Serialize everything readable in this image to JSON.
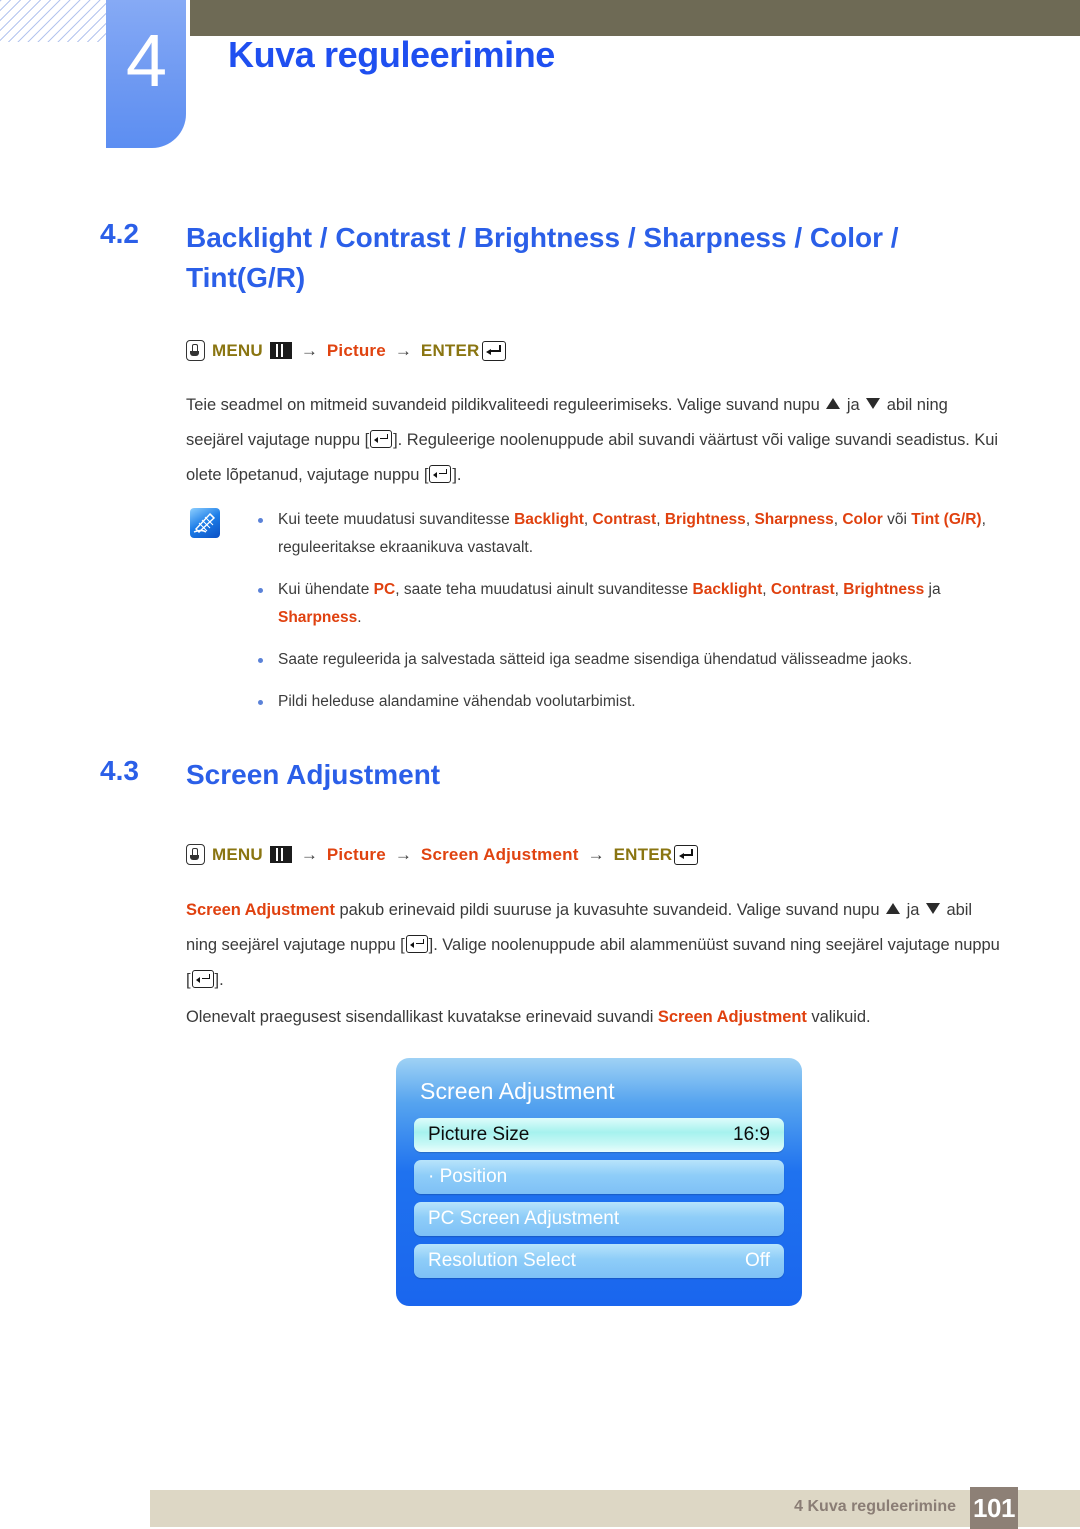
{
  "chapter": {
    "number": "4",
    "title": "Kuva reguleerimine"
  },
  "sections": [
    {
      "number": "4.2",
      "title": "Backlight / Contrast / Brightness / Sharpness / Color / Tint(G/R)",
      "path": {
        "menu_label": "MENU",
        "item_label": "Picture",
        "enter_label": "ENTER",
        "arrow": "→"
      }
    },
    {
      "number": "4.3",
      "title": "Screen Adjustment",
      "path": {
        "menu_label": "MENU",
        "item_label": "Picture",
        "item2_label": "Screen Adjustment",
        "enter_label": "ENTER",
        "arrow": "→"
      }
    }
  ],
  "body": {
    "para1_a": "Teie seadmel on mitmeid suvandeid pildikvaliteedi reguleerimiseks. Valige suvand nupu",
    "para1_b": "ja",
    "para1_c": "abil ning seejärel vajutage nuppu [",
    "para1_d": "]. Reguleerige noolenuppude abil suvandi väärtust või valige suvandi seadistus. Kui olete lõpetanud, vajutage nuppu [",
    "para1_e": "].",
    "para2_kw": "Screen Adjustment",
    "para2_a": "pakub erinevaid pildi suuruse ja kuvasuhte suvandeid. Valige suvand nupu",
    "para2_b": "ja",
    "para2_c": "abil ning seejärel vajutage nuppu [",
    "para2_d": "]. Valige noolenuppude abil alammenüüst suvand ning seejärel vajutage nuppu [",
    "para2_e": "].",
    "para3_a": "Olenevalt praegusest sisendallikast kuvatakse erinevaid suvandi",
    "para3_kw": "Screen Adjustment",
    "para3_b": "valikuid."
  },
  "notes": [
    {
      "prefix": "Kui teete muudatusi suvanditesse",
      "kw1": "Backlight",
      "kw2": "Contrast",
      "kw3": "Brightness",
      "kw4": "Sharpness",
      "kw5": "Color",
      "mid": "või",
      "kw6": "Tint (G/R)",
      "suffix": ", reguleeritakse ekraanikuva vastavalt."
    },
    {
      "prefix": "Kui ühendate",
      "kw1": "PC",
      "mid": ", saate teha muudatusi ainult suvanditesse",
      "kw2": "Backlight",
      "kw3": "Contrast",
      "kw4": "Brightness",
      "conj": "ja",
      "kw5": "Sharpness",
      "suffix": "."
    },
    {
      "text": "Saate reguleerida ja salvestada sätteid iga seadme sisendiga ühendatud välisseadme jaoks."
    },
    {
      "text": "Pildi heleduse alandamine vähendab voolutarbimist."
    }
  ],
  "osd": {
    "title": "Screen Adjustment",
    "rows": [
      {
        "label": "Picture Size",
        "value": "16:9",
        "selected": true
      },
      {
        "label": "· Position",
        "value": "",
        "selected": false
      },
      {
        "label": "PC Screen Adjustment",
        "value": "",
        "selected": false
      },
      {
        "label": "Resolution Select",
        "value": "Off",
        "selected": false
      }
    ]
  },
  "footer": {
    "text": "4 Kuva reguleerimine",
    "page": "101"
  },
  "colors": {
    "heading_blue": "#2b5fe8",
    "keyword_red": "#e0410f",
    "path_olive": "#8a7511",
    "olive_bar": "#6e6a55",
    "tab_blue": "#6e99f2",
    "footer_bar": "#ddd7c5",
    "page_box": "#8d8076"
  }
}
